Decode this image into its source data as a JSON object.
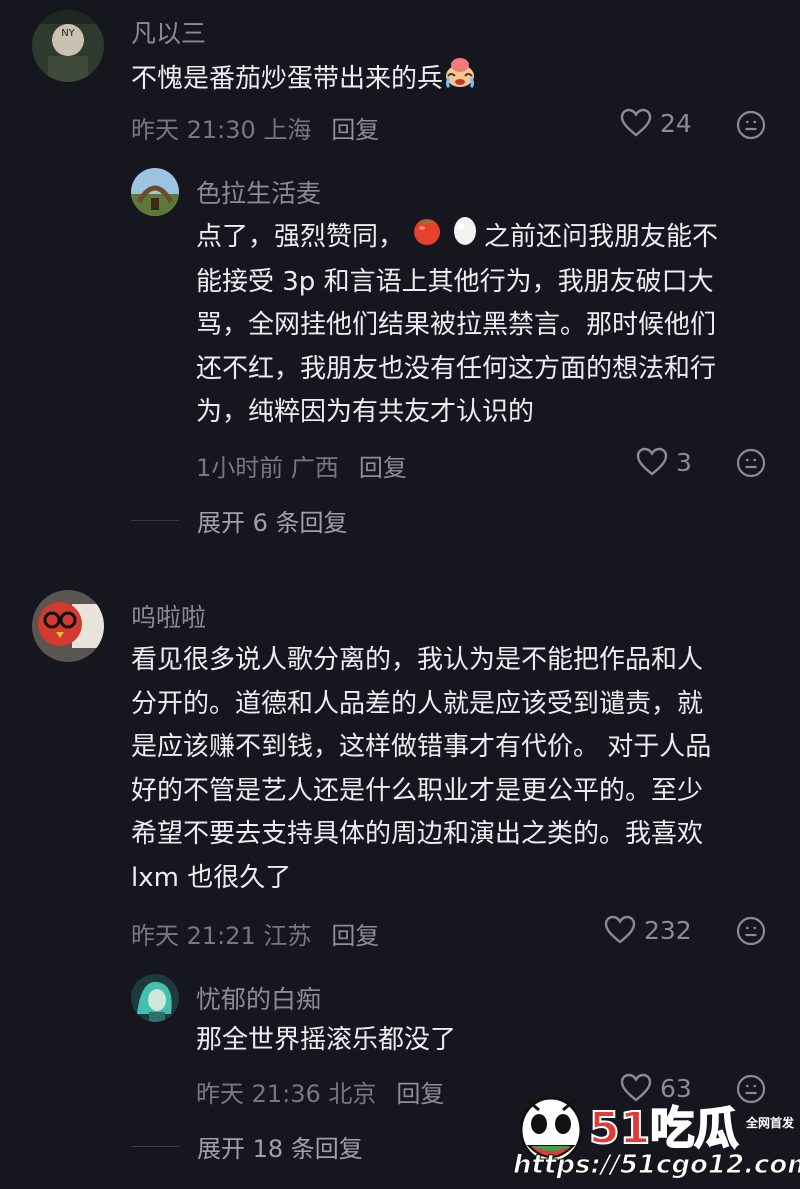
{
  "comments": [
    {
      "user": "凡以三",
      "lines": [
        "不愧是番茄炒蛋带出来的兵"
      ],
      "time": "昨天 21:30 上海",
      "reply": "回复",
      "likes": "24"
    },
    {
      "user": "色拉生活麦",
      "lines": [
        "点了，强烈赞同，",
        "之前还问我朋友能不",
        "能接受 3p 和言语上其他行为，我朋友破口大",
        "骂，全网挂他们结果被拉黑禁言。那时候他们",
        "还不红，我朋友也没有任何这方面的想法和行",
        "为，纯粹因为有共友才认识的"
      ],
      "time": "1小时前 广西",
      "reply": "回复",
      "likes": "3"
    },
    {
      "user": "呜啦啦",
      "lines": [
        "看见很多说人歌分离的，我认为是不能把作品和人",
        "分开的。道德和人品差的人就是应该受到谴责，就",
        "是应该赚不到钱，这样做错事才有代价。 对于人品",
        "好的不管是艺人还是什么职业才是更公平的。至少",
        "希望不要去支持具体的周边和演出之类的。我喜欢",
        "lxm 也很久了"
      ],
      "time": "昨天 21:21 江苏",
      "reply": "回复",
      "likes": "232"
    },
    {
      "user": "忧郁的白痴",
      "lines": [
        "那全世界摇滚乐都没了"
      ],
      "time": "昨天 21:36 北京",
      "reply": "回复",
      "likes": "63"
    }
  ],
  "expand": [
    "展开 6 条回复",
    "展开 18 条回复"
  ],
  "watermark": {
    "brand": "51吃瓜",
    "tag": "全网首发",
    "url": "https://51cgo12.com"
  },
  "icons": {
    "like": "heart-outline-icon",
    "dislike": "meh-face-icon",
    "emoji1": "crying-face-emoji",
    "emoji2": "tomato-emoji",
    "emoji3": "egg-emoji"
  },
  "colors": {
    "background": "#16161e",
    "text": "#ececf1",
    "muted": "#8b8b93"
  }
}
